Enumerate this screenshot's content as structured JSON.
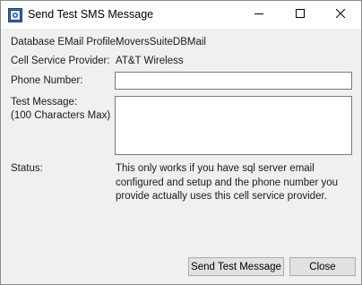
{
  "window": {
    "title": "Send Test SMS Message",
    "icons": {
      "app": "app-window-icon",
      "minimize": "minimize-icon",
      "maximize": "maximize-icon",
      "close": "close-icon"
    }
  },
  "form": {
    "db_profile_label": "Database EMail Profile:",
    "db_profile_value": "MoversSuiteDBMail",
    "provider_label": "Cell Service Provider:",
    "provider_value": "AT&T Wireless",
    "phone_label": "Phone Number:",
    "phone_value": "",
    "message_label_line1": "Test Message:",
    "message_label_line2": "(100 Characters Max)",
    "message_value": "",
    "status_label": "Status:",
    "status_text": "This only works if you have sql server email configured and setup and the phone number you provide actually uses this cell service provider."
  },
  "buttons": {
    "send_label": "Send Test Message",
    "close_label": "Close"
  }
}
